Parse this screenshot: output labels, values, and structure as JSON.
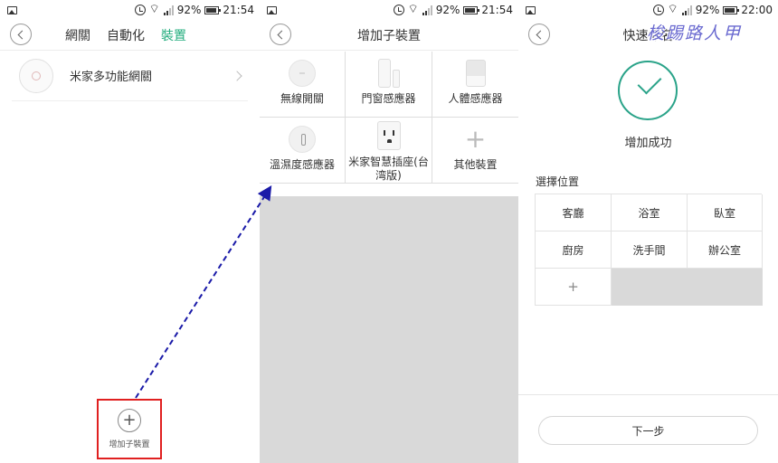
{
  "status_left": {
    "time": "21:54",
    "battery": "92%"
  },
  "status_mid": {
    "time": "21:54",
    "battery": "92%"
  },
  "status_right": {
    "time": "22:00",
    "battery": "92%"
  },
  "panel1": {
    "tabs": [
      "網關",
      "自動化",
      "裝置"
    ],
    "active_tab_index": 2,
    "gateway_label": "米家多功能網關",
    "add_label": "增加子裝置",
    "add_icon": "+"
  },
  "panel2": {
    "title": "增加子裝置",
    "devices": [
      {
        "label": "無線開關",
        "icon": "wireless-switch-icon"
      },
      {
        "label": "門窗感應器",
        "icon": "door-sensor-icon"
      },
      {
        "label": "人體感應器",
        "icon": "motion-sensor-icon"
      },
      {
        "label": "溫濕度感應器",
        "icon": "temperature-sensor-icon"
      },
      {
        "label": "米家智慧插座(台湾版)",
        "icon": "smart-plug-icon"
      },
      {
        "label": "其他裝置",
        "icon": "plus-icon"
      }
    ]
  },
  "panel3": {
    "title": "快速命名",
    "success_text": "增加成功",
    "location_title": "選擇位置",
    "locations": [
      "客廳",
      "浴室",
      "臥室",
      "廚房",
      "洗手間",
      "辦公室"
    ],
    "add_icon": "+",
    "next_button": "下一步",
    "watermark": "梭踢路人甲"
  },
  "colors": {
    "accent": "#22ac7d",
    "success": "#2aa389",
    "highlight_box": "#e02020",
    "arrow": "#1a1aa8",
    "gray": "#d9d9d9"
  }
}
